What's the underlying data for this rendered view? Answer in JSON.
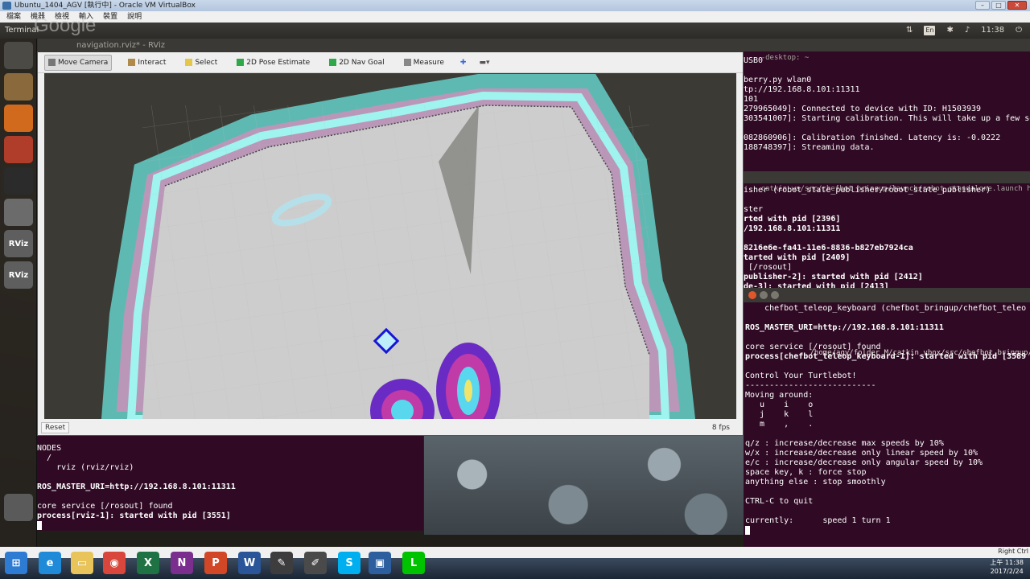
{
  "host": {
    "title": "Ubuntu_1404_AGV [執行中] - Oracle VM VirtualBox",
    "menu": [
      "檔案",
      "機器",
      "檢視",
      "輸入",
      "裝置",
      "說明"
    ]
  },
  "panel": {
    "app_name": "Terminal",
    "watermark": "Google",
    "keyboard": "En",
    "time": "11:38"
  },
  "launcher": {
    "items": [
      "dash-icon",
      "files-icon",
      "firefox-icon",
      "settings-icon",
      "terminal-icon",
      "text-editor-icon",
      "rviz-icon",
      "rviz-icon",
      "trash-icon"
    ],
    "rviz_label": "RViz"
  },
  "rviz": {
    "title": "navigation.rviz* - RViz",
    "tools": [
      {
        "label": "Move Camera",
        "icon": "move-camera-icon",
        "active": true
      },
      {
        "label": "Interact",
        "icon": "interact-icon"
      },
      {
        "label": "Select",
        "icon": "select-icon"
      },
      {
        "label": "2D Pose Estimate",
        "icon": "pose-estimate-icon"
      },
      {
        "label": "2D Nav Goal",
        "icon": "nav-goal-icon"
      },
      {
        "label": "Measure",
        "icon": "measure-icon"
      }
    ],
    "reset": "Reset",
    "fps": "8 fps"
  },
  "term_bottom": {
    "lines": [
      {
        "text": "NODES",
        "bold": false
      },
      {
        "text": "  /",
        "bold": false
      },
      {
        "text": "    rviz (rviz/rviz)",
        "bold": false
      },
      {
        "text": "",
        "bold": false
      },
      {
        "text": "ROS_MASTER_URI=http://192.168.8.101:11311",
        "bold": true
      },
      {
        "text": "",
        "bold": false
      },
      {
        "text": "core service [/rosout] found",
        "bold": false
      },
      {
        "text": "process[rviz-1]: started with pid [3551]",
        "bold": true
      }
    ]
  },
  "term_right": {
    "title": "-desktop: ~",
    "lines": [
      {
        "text": "USB0",
        "bold": false
      },
      {
        "text": "",
        "bold": false
      },
      {
        "text": "berry.py wlan0",
        "bold": false
      },
      {
        "text": "tp://192.168.8.101:11311",
        "bold": false
      },
      {
        "text": "101",
        "bold": false
      },
      {
        "text": "279965049]: Connected to device with ID: H1503939",
        "bold": false
      },
      {
        "text": "303541007]: Starting calibration. This will take up a few se",
        "bold": false
      },
      {
        "text": "",
        "bold": false
      },
      {
        "text": "082860906]: Calibration finished. Latency is: -0.0222",
        "bold": false
      },
      {
        "text": "188748397]: Streaming data.",
        "bold": false
      }
    ],
    "path_bar": "catkin_ws/src/chefbot_bringup/launch/robot_standalone.launch http://19",
    "lines2": [
      {
        "text": "isher (robot_state_publisher/robot_state_publisher)",
        "bold": false
      },
      {
        "text": "",
        "bold": false
      },
      {
        "text": "ster",
        "bold": false
      },
      {
        "text": "rted with pid [2396]",
        "bold": true
      },
      {
        "text": "/192.168.8.101:11311",
        "bold": true
      },
      {
        "text": "",
        "bold": false
      },
      {
        "text": "8216e6e-fa41-11e6-8836-b827eb7924ca",
        "bold": true
      },
      {
        "text": "tarted with pid [2409]",
        "bold": true
      },
      {
        "text": " [/rosout]",
        "bold": false
      },
      {
        "text": "publisher-2]: started with pid [2412]",
        "bold": true
      },
      {
        "text": "de-3]: started with pid [2413]",
        "bold": true
      }
    ]
  },
  "teleop": {
    "title": "/home/agv/folder_M/catkin_vbox/src/chefbot_bringup/launch",
    "lines": [
      {
        "text": "    chefbot_teleop_keyboard (chefbot_bringup/chefbot_teleo",
        "bold": false
      },
      {
        "text": "",
        "bold": false
      },
      {
        "text": "ROS_MASTER_URI=http://192.168.8.101:11311",
        "bold": true
      },
      {
        "text": "",
        "bold": false
      },
      {
        "text": "core service [/rosout] found",
        "bold": false
      },
      {
        "text": "process[chefbot_teleop_keyboard-1]: started with pid [3589",
        "bold": true
      },
      {
        "text": "",
        "bold": false
      },
      {
        "text": "Control Your Turtlebot!",
        "bold": false
      },
      {
        "text": "---------------------------",
        "bold": false
      },
      {
        "text": "Moving around:",
        "bold": false
      },
      {
        "text": "   u    i    o",
        "bold": false
      },
      {
        "text": "   j    k    l",
        "bold": false
      },
      {
        "text": "   m    ,    .",
        "bold": false
      },
      {
        "text": "",
        "bold": false
      },
      {
        "text": "q/z : increase/decrease max speeds by 10%",
        "bold": false
      },
      {
        "text": "w/x : increase/decrease only linear speed by 10%",
        "bold": false
      },
      {
        "text": "e/c : increase/decrease only angular speed by 10%",
        "bold": false
      },
      {
        "text": "space key, k : force stop",
        "bold": false
      },
      {
        "text": "anything else : stop smoothly",
        "bold": false
      },
      {
        "text": "",
        "bold": false
      },
      {
        "text": "CTRL-C to quit",
        "bold": false
      },
      {
        "text": "",
        "bold": false
      },
      {
        "text": "currently:      speed 1 turn 1",
        "bold": false
      }
    ]
  },
  "taskbar": {
    "apps": [
      "start-icon",
      "ie-icon",
      "explorer-icon",
      "chrome-icon",
      "excel-icon",
      "onenote-icon",
      "powerpoint-icon",
      "word-icon",
      "pencil-icon",
      "edit-icon",
      "skype-icon",
      "virtualbox-icon",
      "line-icon"
    ],
    "time": "上午 11:38",
    "date": "2017/2/24",
    "right_ctrl": "Right Ctrl"
  }
}
